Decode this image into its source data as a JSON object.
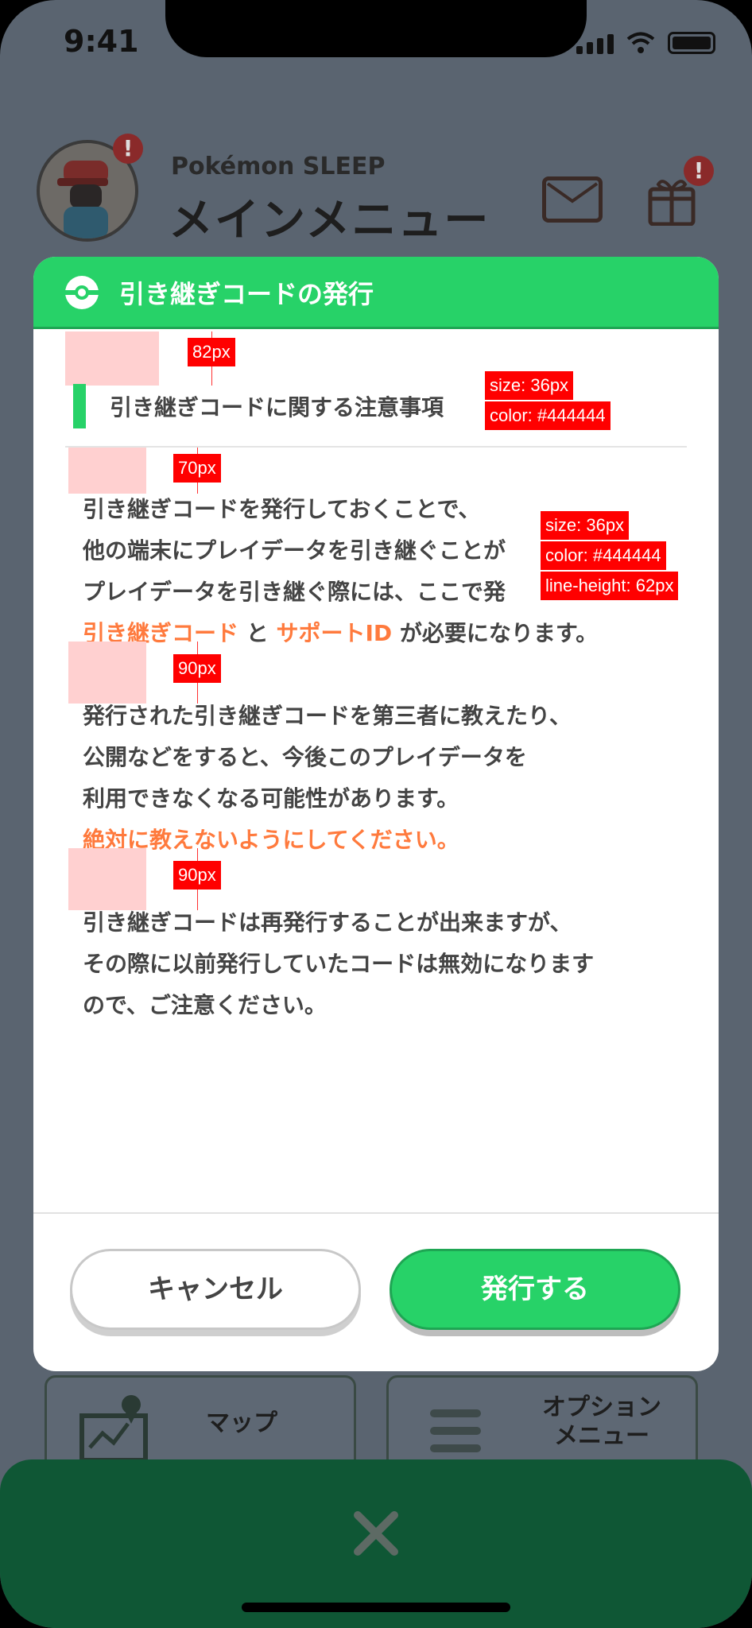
{
  "status_bar": {
    "time": "9:41"
  },
  "header": {
    "app_name": "Pokémon SLEEP",
    "title": "メインメニュー",
    "avatar_badge": "!",
    "gift_badge": "!"
  },
  "modal": {
    "title": "引き継ぎコードの発行",
    "section_title": "引き継ぎコードに関する注意事項",
    "paragraph1": {
      "line1": "引き継ぎコードを発行しておくことで、",
      "line2": "他の端末にプレイデータを引き継ぐことが",
      "line3": "プレイデータを引き継ぐ際には、ここで発",
      "line4_code": "引き継ぎコード",
      "line4_and": " と ",
      "line4_support": "サポートID",
      "line4_rest": " が必要になります。"
    },
    "paragraph2": {
      "line1": "発行された引き継ぎコードを第三者に教えたり、",
      "line2": "公開などをすると、今後このプレイデータを",
      "line3": "利用できなくなる可能性があります。",
      "warning": "絶対に教えないようにしてください。"
    },
    "paragraph3": {
      "line1": "引き継ぎコードは再発行することが出来ますが、",
      "line2": "その際に以前発行していたコードは無効になります",
      "line3": "ので、ご注意ください。"
    },
    "cancel_label": "キャンセル",
    "issue_label": "発行する"
  },
  "annotations": {
    "gap1": "82px",
    "title_size": "size: 36px",
    "title_color": "color: #444444",
    "gap2": "70px",
    "body_size": "size: 36px",
    "body_color": "color: #444444",
    "body_line_height": "line-height: 62px",
    "gap3": "90px",
    "gap4": "90px"
  },
  "background_menu": {
    "map_label": "マップ",
    "option_line1": "オプション",
    "option_line2": "メニュー"
  },
  "colors": {
    "accent_green": "#27d268",
    "highlight_orange": "#ff7a3d",
    "text": "#444444",
    "bottom_bar": "#0f5735"
  }
}
